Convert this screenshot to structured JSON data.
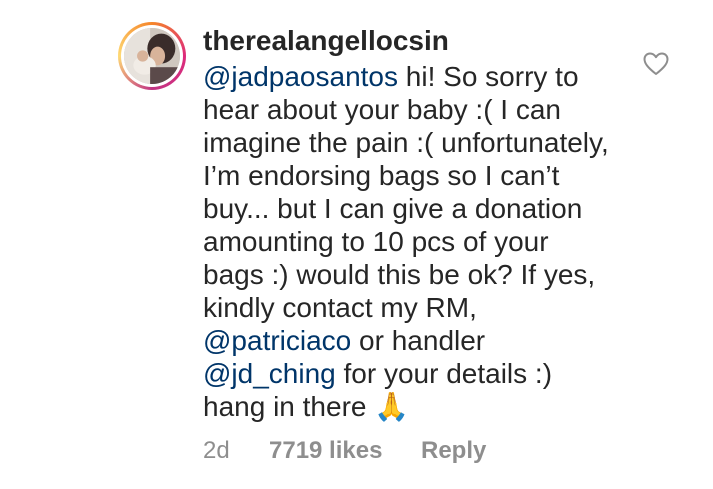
{
  "comment": {
    "username": "therealangellocsin",
    "mention_1": "@jadpaosantos",
    "text_1": " hi! So sorry to\nhear about your baby :( I can\nimagine the pain :( unfortunately,\nI’m endorsing bags so I can’t\nbuy... but I can give a donation\namounting to 10 pcs of your\nbags :) would this be ok? If yes,\nkindly contact my RM,\n",
    "mention_2": "@patriciaco",
    "text_2": " or handler\n",
    "mention_3": "@jd_ching",
    "text_3": "  for your details :)\nhang in there 🙏",
    "age": "2d",
    "likes": "7719 likes",
    "reply_label": "Reply",
    "like_icon": "heart-outline-icon"
  },
  "colors": {
    "text": "#262626",
    "mention": "#003569",
    "meta": "#8e8e8e",
    "heart": "#8e8e8e"
  }
}
